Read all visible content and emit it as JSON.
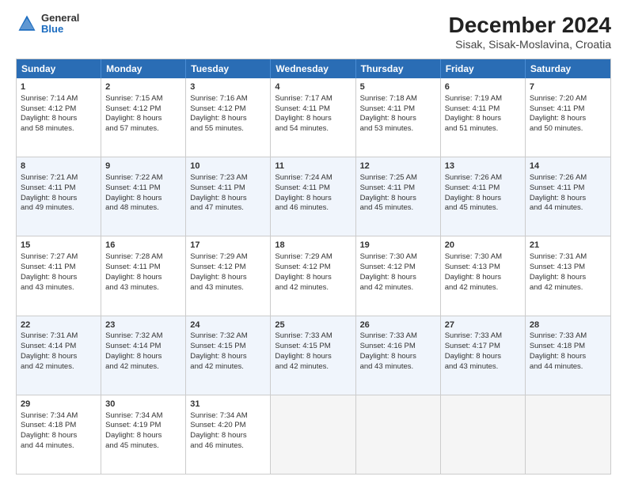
{
  "logo": {
    "general": "General",
    "blue": "Blue"
  },
  "header": {
    "title": "December 2024",
    "subtitle": "Sisak, Sisak-Moslavina, Croatia"
  },
  "weekdays": [
    "Sunday",
    "Monday",
    "Tuesday",
    "Wednesday",
    "Thursday",
    "Friday",
    "Saturday"
  ],
  "rows": [
    [
      {
        "day": "1",
        "lines": [
          "Sunrise: 7:14 AM",
          "Sunset: 4:12 PM",
          "Daylight: 8 hours",
          "and 58 minutes."
        ]
      },
      {
        "day": "2",
        "lines": [
          "Sunrise: 7:15 AM",
          "Sunset: 4:12 PM",
          "Daylight: 8 hours",
          "and 57 minutes."
        ]
      },
      {
        "day": "3",
        "lines": [
          "Sunrise: 7:16 AM",
          "Sunset: 4:12 PM",
          "Daylight: 8 hours",
          "and 55 minutes."
        ]
      },
      {
        "day": "4",
        "lines": [
          "Sunrise: 7:17 AM",
          "Sunset: 4:11 PM",
          "Daylight: 8 hours",
          "and 54 minutes."
        ]
      },
      {
        "day": "5",
        "lines": [
          "Sunrise: 7:18 AM",
          "Sunset: 4:11 PM",
          "Daylight: 8 hours",
          "and 53 minutes."
        ]
      },
      {
        "day": "6",
        "lines": [
          "Sunrise: 7:19 AM",
          "Sunset: 4:11 PM",
          "Daylight: 8 hours",
          "and 51 minutes."
        ]
      },
      {
        "day": "7",
        "lines": [
          "Sunrise: 7:20 AM",
          "Sunset: 4:11 PM",
          "Daylight: 8 hours",
          "and 50 minutes."
        ]
      }
    ],
    [
      {
        "day": "8",
        "lines": [
          "Sunrise: 7:21 AM",
          "Sunset: 4:11 PM",
          "Daylight: 8 hours",
          "and 49 minutes."
        ]
      },
      {
        "day": "9",
        "lines": [
          "Sunrise: 7:22 AM",
          "Sunset: 4:11 PM",
          "Daylight: 8 hours",
          "and 48 minutes."
        ]
      },
      {
        "day": "10",
        "lines": [
          "Sunrise: 7:23 AM",
          "Sunset: 4:11 PM",
          "Daylight: 8 hours",
          "and 47 minutes."
        ]
      },
      {
        "day": "11",
        "lines": [
          "Sunrise: 7:24 AM",
          "Sunset: 4:11 PM",
          "Daylight: 8 hours",
          "and 46 minutes."
        ]
      },
      {
        "day": "12",
        "lines": [
          "Sunrise: 7:25 AM",
          "Sunset: 4:11 PM",
          "Daylight: 8 hours",
          "and 45 minutes."
        ]
      },
      {
        "day": "13",
        "lines": [
          "Sunrise: 7:26 AM",
          "Sunset: 4:11 PM",
          "Daylight: 8 hours",
          "and 45 minutes."
        ]
      },
      {
        "day": "14",
        "lines": [
          "Sunrise: 7:26 AM",
          "Sunset: 4:11 PM",
          "Daylight: 8 hours",
          "and 44 minutes."
        ]
      }
    ],
    [
      {
        "day": "15",
        "lines": [
          "Sunrise: 7:27 AM",
          "Sunset: 4:11 PM",
          "Daylight: 8 hours",
          "and 43 minutes."
        ]
      },
      {
        "day": "16",
        "lines": [
          "Sunrise: 7:28 AM",
          "Sunset: 4:11 PM",
          "Daylight: 8 hours",
          "and 43 minutes."
        ]
      },
      {
        "day": "17",
        "lines": [
          "Sunrise: 7:29 AM",
          "Sunset: 4:12 PM",
          "Daylight: 8 hours",
          "and 43 minutes."
        ]
      },
      {
        "day": "18",
        "lines": [
          "Sunrise: 7:29 AM",
          "Sunset: 4:12 PM",
          "Daylight: 8 hours",
          "and 42 minutes."
        ]
      },
      {
        "day": "19",
        "lines": [
          "Sunrise: 7:30 AM",
          "Sunset: 4:12 PM",
          "Daylight: 8 hours",
          "and 42 minutes."
        ]
      },
      {
        "day": "20",
        "lines": [
          "Sunrise: 7:30 AM",
          "Sunset: 4:13 PM",
          "Daylight: 8 hours",
          "and 42 minutes."
        ]
      },
      {
        "day": "21",
        "lines": [
          "Sunrise: 7:31 AM",
          "Sunset: 4:13 PM",
          "Daylight: 8 hours",
          "and 42 minutes."
        ]
      }
    ],
    [
      {
        "day": "22",
        "lines": [
          "Sunrise: 7:31 AM",
          "Sunset: 4:14 PM",
          "Daylight: 8 hours",
          "and 42 minutes."
        ]
      },
      {
        "day": "23",
        "lines": [
          "Sunrise: 7:32 AM",
          "Sunset: 4:14 PM",
          "Daylight: 8 hours",
          "and 42 minutes."
        ]
      },
      {
        "day": "24",
        "lines": [
          "Sunrise: 7:32 AM",
          "Sunset: 4:15 PM",
          "Daylight: 8 hours",
          "and 42 minutes."
        ]
      },
      {
        "day": "25",
        "lines": [
          "Sunrise: 7:33 AM",
          "Sunset: 4:15 PM",
          "Daylight: 8 hours",
          "and 42 minutes."
        ]
      },
      {
        "day": "26",
        "lines": [
          "Sunrise: 7:33 AM",
          "Sunset: 4:16 PM",
          "Daylight: 8 hours",
          "and 43 minutes."
        ]
      },
      {
        "day": "27",
        "lines": [
          "Sunrise: 7:33 AM",
          "Sunset: 4:17 PM",
          "Daylight: 8 hours",
          "and 43 minutes."
        ]
      },
      {
        "day": "28",
        "lines": [
          "Sunrise: 7:33 AM",
          "Sunset: 4:18 PM",
          "Daylight: 8 hours",
          "and 44 minutes."
        ]
      }
    ],
    [
      {
        "day": "29",
        "lines": [
          "Sunrise: 7:34 AM",
          "Sunset: 4:18 PM",
          "Daylight: 8 hours",
          "and 44 minutes."
        ]
      },
      {
        "day": "30",
        "lines": [
          "Sunrise: 7:34 AM",
          "Sunset: 4:19 PM",
          "Daylight: 8 hours",
          "and 45 minutes."
        ]
      },
      {
        "day": "31",
        "lines": [
          "Sunrise: 7:34 AM",
          "Sunset: 4:20 PM",
          "Daylight: 8 hours",
          "and 46 minutes."
        ]
      },
      null,
      null,
      null,
      null
    ]
  ]
}
